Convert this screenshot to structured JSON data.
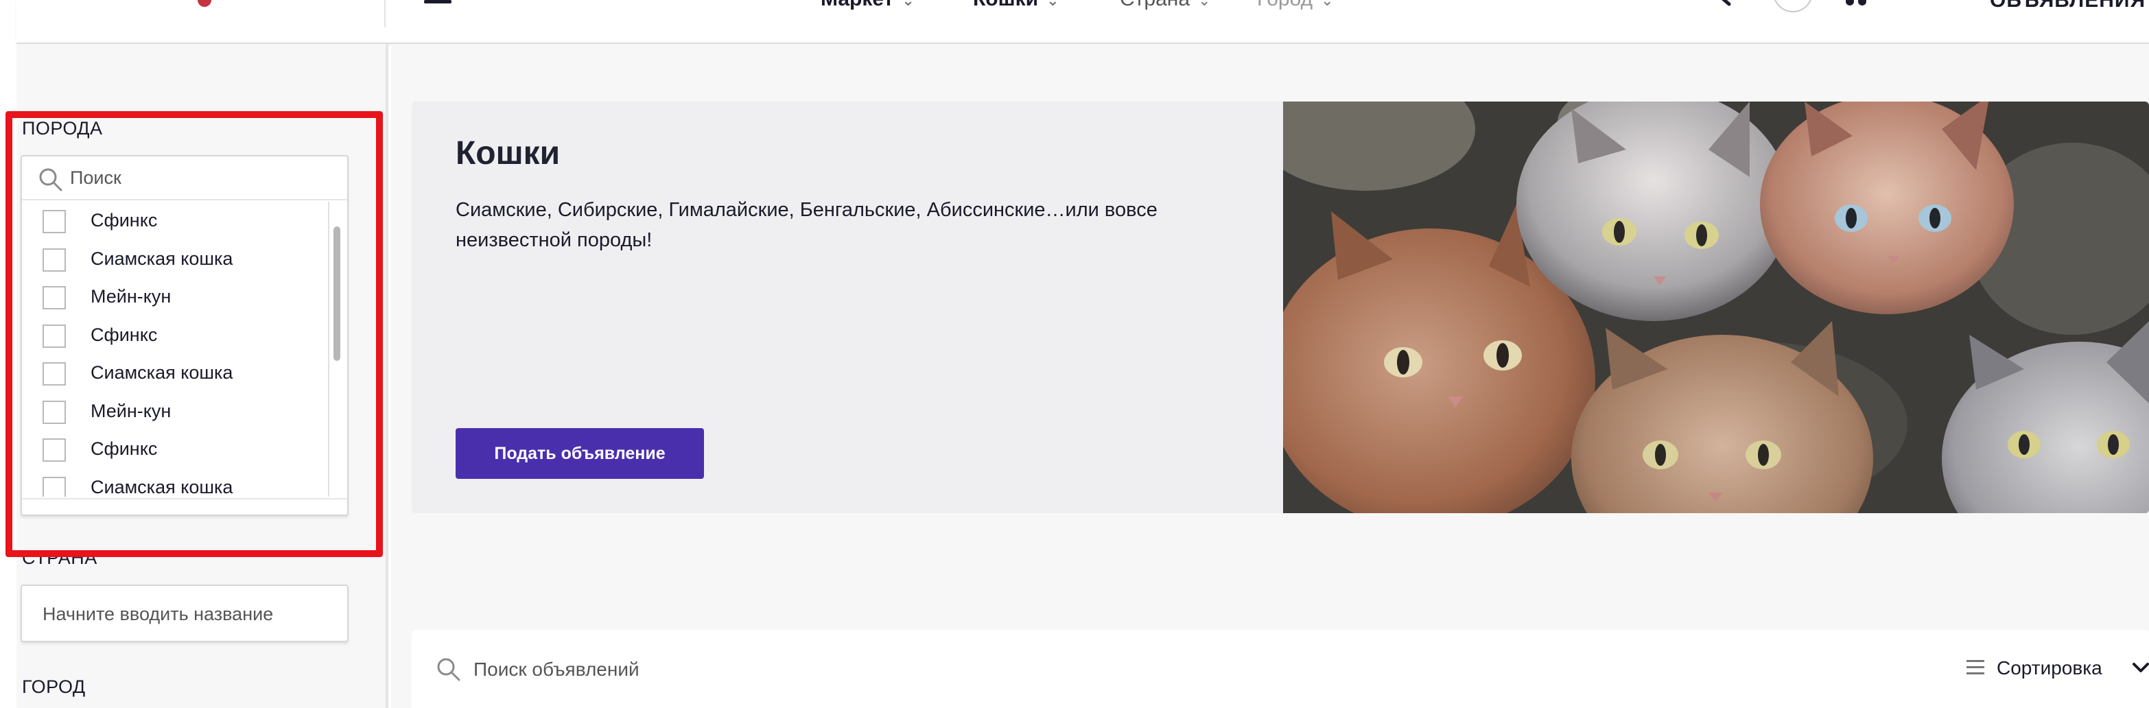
{
  "header": {
    "nav": [
      {
        "label": "Маркет"
      },
      {
        "label": "Кошки"
      },
      {
        "label": "Страна"
      },
      {
        "label": "Город"
      }
    ],
    "post_label": "ОБЪЯВЛЕНИЯ",
    "icons": [
      "menu-icon",
      "search-icon",
      "user-avatar",
      "cart-icon",
      "chevron-down-icon"
    ]
  },
  "sidebar": {
    "breed": {
      "label": "ПОРОДА",
      "search_placeholder": "Поиск",
      "items": [
        {
          "label": "Сфинкс",
          "checked": false
        },
        {
          "label": "Сиамская кошка",
          "checked": false
        },
        {
          "label": "Мейн-кун",
          "checked": false
        },
        {
          "label": "Сфинкс",
          "checked": false
        },
        {
          "label": "Сиамская кошка",
          "checked": false
        },
        {
          "label": "Мейн-кун",
          "checked": false
        },
        {
          "label": "Сфинкс",
          "checked": false
        },
        {
          "label": "Сиамская кошка",
          "checked": false
        }
      ]
    },
    "country": {
      "label": "СТРАНА",
      "placeholder": "Начните вводить название"
    },
    "city": {
      "label": "ГОРОД"
    }
  },
  "hero": {
    "title": "Кошки",
    "description": "Сиамские, Сибирские, Гималайские, Бенгальские, Абиссинские…или вовсе неизвестной породы!",
    "button_label": "Подать объявление",
    "button_color": "#4a2fad"
  },
  "listing": {
    "search_placeholder": "Поиск объявлений",
    "sort_label": "Сортировка"
  },
  "colors": {
    "highlight": "#e8131b",
    "brand_logo": "#c4333f"
  }
}
